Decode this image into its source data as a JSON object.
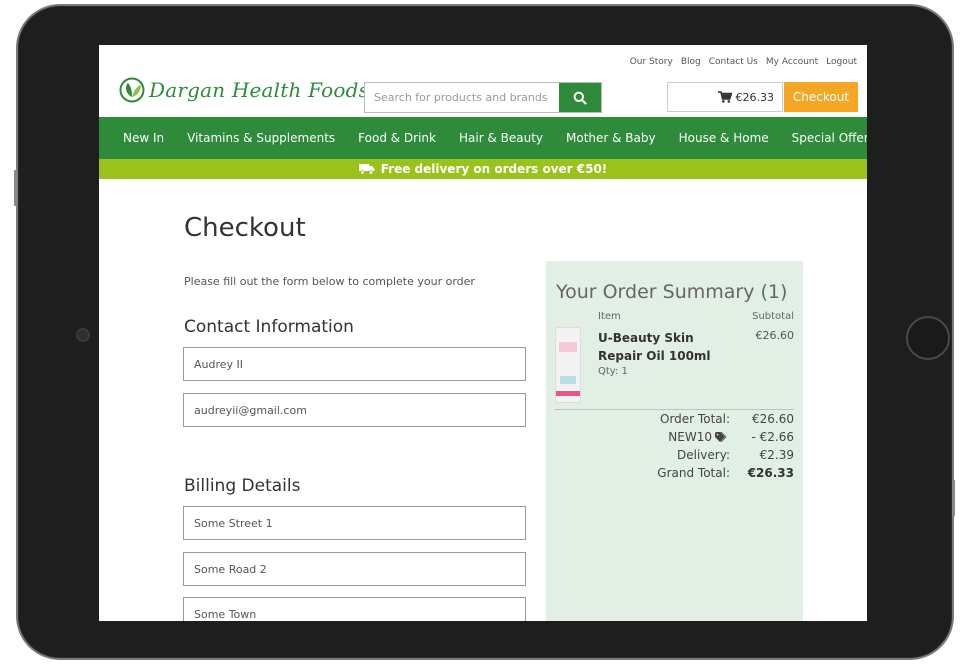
{
  "top_links": [
    "Our Story",
    "Blog",
    "Contact Us",
    "My Account",
    "Logout"
  ],
  "logo": {
    "text": "Dargan Health Foods"
  },
  "search": {
    "placeholder": "Search for products and brands"
  },
  "cart": {
    "total": "€26.33"
  },
  "checkout_button": "Checkout",
  "nav": [
    "New In",
    "Vitamins & Supplements",
    "Food & Drink",
    "Hair & Beauty",
    "Mother & Baby",
    "House & Home",
    "Special Offers"
  ],
  "promo": {
    "text": "Free delivery on orders over €50!"
  },
  "page": {
    "title": "Checkout",
    "intro": "Please fill out the form below to complete your order"
  },
  "contact": {
    "heading": "Contact Information",
    "name": "Audrey II",
    "email": "audreyii@gmail.com"
  },
  "billing": {
    "heading": "Billing Details",
    "address1": "Some Street 1",
    "address2": "Some Road 2",
    "town": "Some Town"
  },
  "summary": {
    "title": "Your Order Summary (1)",
    "col_item": "Item",
    "col_subtotal": "Subtotal",
    "product": {
      "name": "U-Beauty Skin Repair Oil 100ml",
      "qty": "Qty: 1",
      "price": "€26.60"
    },
    "order_total_label": "Order Total:",
    "order_total": "€26.60",
    "discount_label": "NEW10",
    "discount": "- €2.66",
    "delivery_label": "Delivery:",
    "delivery": "€2.39",
    "grand_total_label": "Grand Total:",
    "grand_total": "€26.33"
  },
  "colors": {
    "brand_green": "#2e8b3a",
    "promo_green": "#9bc21a",
    "checkout_orange": "#f5a623",
    "summary_bg": "#e2efe4"
  },
  "icons": [
    "leaf-logo-icon",
    "search-icon",
    "cart-icon",
    "truck-icon",
    "tag-icon"
  ]
}
